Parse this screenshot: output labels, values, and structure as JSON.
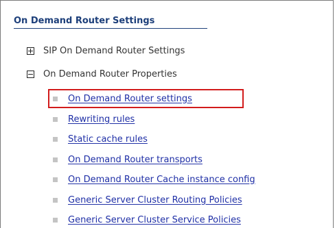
{
  "panel": {
    "title": "On Demand Router Settings"
  },
  "tree": {
    "nodes": [
      {
        "label": "SIP On Demand Router Settings",
        "state": "collapsed",
        "toggle_icon": "plus-box-icon"
      },
      {
        "label": "On Demand Router Properties",
        "state": "expanded",
        "toggle_icon": "minus-box-icon"
      }
    ],
    "links": [
      {
        "label": "On Demand Router settings",
        "highlighted": true
      },
      {
        "label": "Rewriting rules"
      },
      {
        "label": "Static cache rules"
      },
      {
        "label": "On Demand Router transports"
      },
      {
        "label": "On Demand Router Cache instance config"
      },
      {
        "label": "Generic Server Cluster Routing Policies"
      },
      {
        "label": "Generic Server Cluster Service Policies"
      }
    ]
  },
  "colors": {
    "title": "#1d3f7a",
    "link": "#1f2fa6",
    "highlight": "#d21b1b",
    "bullet": "#c4c4c4"
  }
}
